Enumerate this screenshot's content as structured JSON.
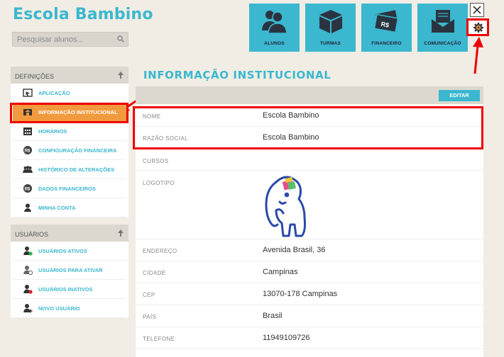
{
  "app": {
    "title": "Escola Bambino"
  },
  "search": {
    "placeholder": "Pesquisar alunos..."
  },
  "topnav": [
    {
      "label": "ALUNOS",
      "icon": "students-icon"
    },
    {
      "label": "TURMAS",
      "icon": "box-icon"
    },
    {
      "label": "FINANCEIRO",
      "icon": "money-icon"
    },
    {
      "label": "COMUNICAÇÃO",
      "icon": "envelope-icon"
    }
  ],
  "sidebar": {
    "definicoes": {
      "title": "DEFINIÇÕES",
      "items": [
        {
          "label": "APLICAÇÃO"
        },
        {
          "label": "INFORMAÇÃO INSTITUCIONAL",
          "active": true
        },
        {
          "label": "HORÁRIOS"
        },
        {
          "label": "CONFIGURAÇÃO FINANCEIRA"
        },
        {
          "label": "HISTÓRICO DE ALTERAÇÕES"
        },
        {
          "label": "DADOS FINANCEIROS"
        },
        {
          "label": "MINHA CONTA"
        }
      ]
    },
    "usuarios": {
      "title": "USUÁRIOS",
      "items": [
        {
          "label": "USUÁRIOS ATIVOS"
        },
        {
          "label": "USUÁRIOS PARA ATIVAR"
        },
        {
          "label": "USUÁRIOS INATIVOS"
        },
        {
          "label": "NOVO USUÁRIO"
        }
      ]
    }
  },
  "main": {
    "title": "INFORMAÇÃO INSTITUCIONAL",
    "edit_label": "EDITAR",
    "fields": [
      {
        "key": "NOME",
        "value": "Escola Bambino"
      },
      {
        "key": "RAZÃO SOCIAL",
        "value": "Escola Bambino"
      },
      {
        "key": "CURSOS",
        "value": ""
      },
      {
        "key": "LOGOTIPO",
        "value": ""
      },
      {
        "key": "ENDEREÇO",
        "value": "Avenida Brasil, 36"
      },
      {
        "key": "CIDADE",
        "value": "Campinas"
      },
      {
        "key": "CEP",
        "value": "13070-178 Campinas"
      },
      {
        "key": "PAÍS",
        "value": "Brasil"
      },
      {
        "key": "TELEFONE",
        "value": "11949109726"
      }
    ]
  },
  "colors": {
    "accent": "#3bb7cf",
    "active": "#f29a3e",
    "highlight": "#ee0000"
  }
}
